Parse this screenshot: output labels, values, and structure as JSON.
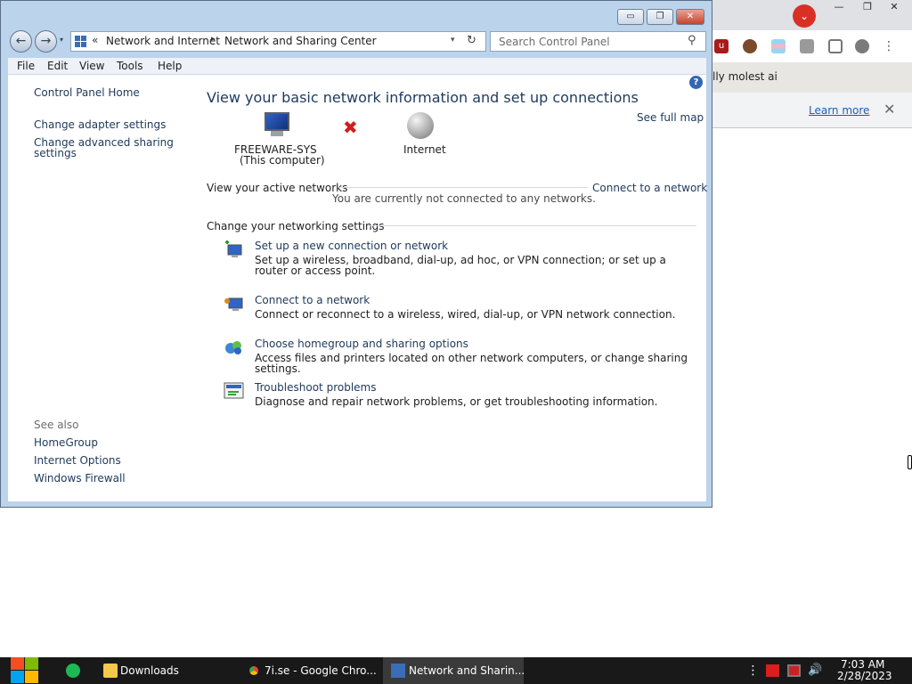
{
  "explorer": {
    "window_controls": {
      "minimize": "▭",
      "maximize": "❐",
      "close": "✕"
    },
    "nav": {
      "back": "←",
      "forward": "→",
      "recent": "▾"
    },
    "address": {
      "prefix": "«",
      "crumbs": [
        "Network and Internet",
        "Network and Sharing Center"
      ],
      "separator": "▸",
      "dropdown": "▾",
      "refresh": "↻"
    },
    "search": {
      "placeholder": "Search Control Panel",
      "icon": "search-icon"
    },
    "menu": [
      "File",
      "Edit",
      "View",
      "Tools",
      "Help"
    ],
    "help_icon": "?",
    "sidebar": {
      "home": "Control Panel Home",
      "links": [
        "Change adapter settings",
        "Change advanced sharing settings"
      ],
      "see_also_heading": "See also",
      "see_also": [
        "HomeGroup",
        "Internet Options",
        "Windows Firewall"
      ]
    },
    "main": {
      "heading": "View your basic network information and set up connections",
      "see_full_map": "See full map",
      "computer_name": "FREEWARE-SYS",
      "computer_sub": "(This computer)",
      "disconnected_mark": "✖",
      "internet_label": "Internet",
      "active_networks_label": "View your active networks",
      "not_connected": "You are currently not connected to any networks.",
      "connect_link": "Connect to a network",
      "change_settings_label": "Change your networking settings",
      "tasks": [
        {
          "icon": "new-connection-icon",
          "title": "Set up a new connection or network",
          "desc": "Set up a wireless, broadband, dial-up, ad hoc, or VPN connection; or set up a router or access point."
        },
        {
          "icon": "connect-network-icon",
          "title": "Connect to a network",
          "desc": "Connect or reconnect to a wireless, wired, dial-up, or VPN network connection."
        },
        {
          "icon": "homegroup-icon",
          "title": "Choose homegroup and sharing options",
          "desc": "Access files and printers located on other network computers, or change sharing settings."
        },
        {
          "icon": "troubleshoot-icon",
          "title": "Troubleshoot problems",
          "desc": "Diagnose and repair network problems, or get troubleshooting information."
        }
      ]
    }
  },
  "chrome_background": {
    "window_controls": {
      "minimize": "—",
      "maximize": "❐",
      "close": "✕"
    },
    "tab_button": "⌄",
    "partial_text": "lly molest ai",
    "learn_more": "Learn more",
    "infobar_close": "✕"
  },
  "taskbar": {
    "items": [
      {
        "label": "Downloads",
        "icon": "folder-icon"
      },
      {
        "label": "7i.se - Google Chro...",
        "icon": "chrome-icon"
      },
      {
        "label": "Network and Sharin...",
        "icon": "network-center-icon"
      }
    ],
    "tray_more": "⋮",
    "clock_time": "7:03 AM",
    "clock_date": "2/28/2023"
  },
  "colors": {
    "accent": "#1e395b",
    "window_frame": "#bcd3ec",
    "taskbar": "#191919",
    "close_button": "#c7432c"
  }
}
